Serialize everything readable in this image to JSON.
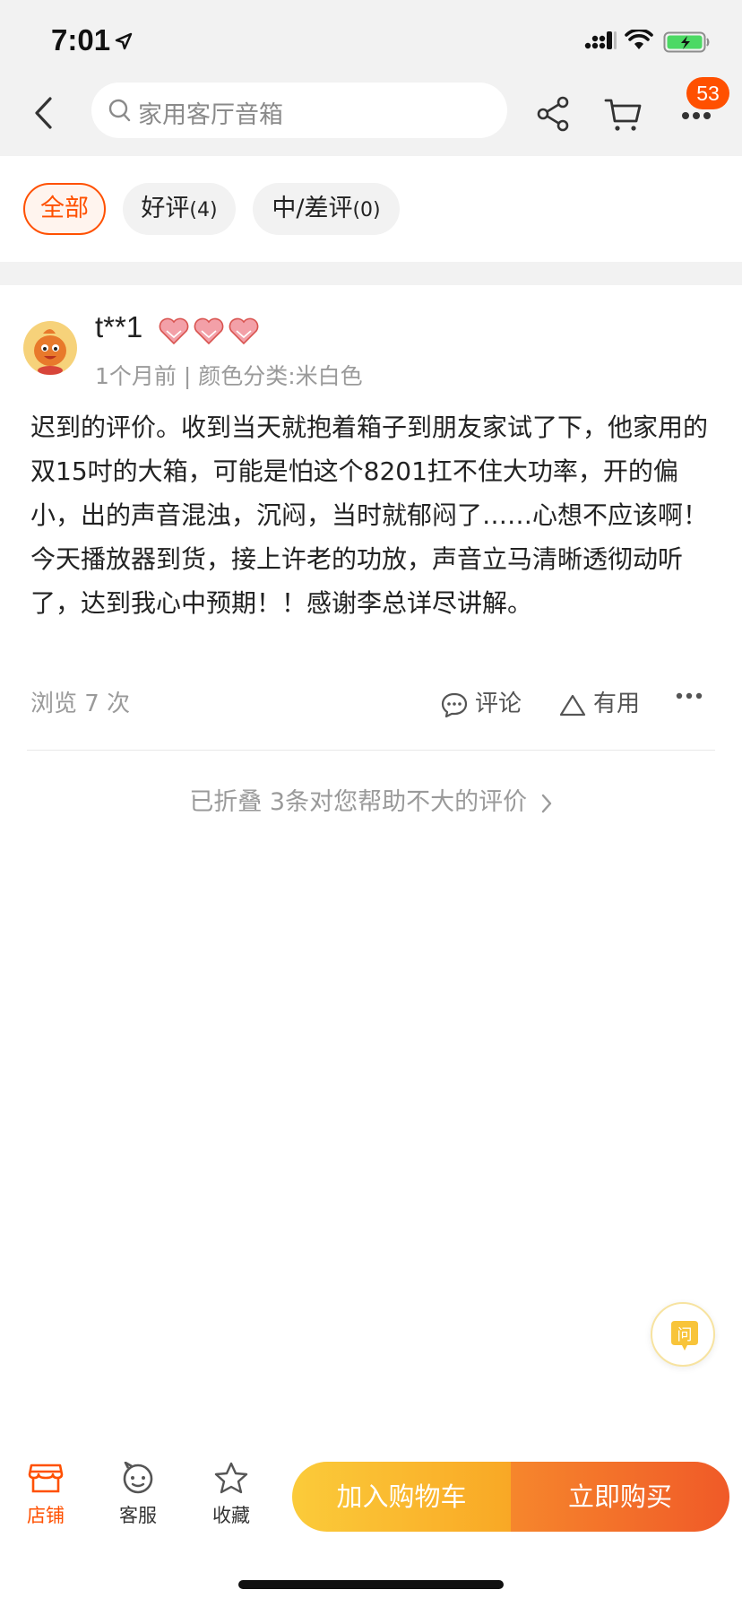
{
  "status_bar": {
    "time": "7:01"
  },
  "header": {
    "search_text": "家用客厅音箱",
    "cart_badge": "53"
  },
  "filters": [
    {
      "label": "全部",
      "count": ""
    },
    {
      "label": "好评",
      "count": "(4)"
    },
    {
      "label": "中/差评",
      "count": "(0)"
    }
  ],
  "review": {
    "username": "t**1",
    "meta": "1个月前 | 颜色分类:米白色",
    "content": "迟到的评价。收到当天就抱着箱子到朋友家试了下，他家用的双15吋的大箱，可能是怕这个8201扛不住大功率，开的偏小，出的声音混浊，沉闷，当时就郁闷了……心想不应该啊！今天播放器到货，接上许老的功放，声音立马清晰透彻动听了，达到我心中预期！！感谢李总详尽讲解。",
    "views": "浏览 7 次",
    "comment_label": "评论",
    "useful_label": "有用"
  },
  "folded_text": "已折叠 3条对您帮助不大的评价",
  "ask_label": "问",
  "bottom_bar": {
    "store": "店铺",
    "service": "客服",
    "favorite": "收藏",
    "add_to_cart": "加入购物车",
    "buy_now": "立即购买"
  },
  "colors": {
    "accent": "#ff5000",
    "cart_button": "#f9b92f",
    "buy_button": "#f06a2a"
  },
  "icons": [
    "location-arrow-icon",
    "signal-icon",
    "wifi-icon",
    "battery-icon",
    "back-chevron-icon",
    "search-icon",
    "share-icon",
    "cart-icon",
    "more-icon",
    "heart-rank-icon",
    "comment-icon",
    "triangle-useful-icon",
    "chevron-right-icon",
    "ask-icon",
    "store-icon",
    "service-icon",
    "star-icon"
  ]
}
